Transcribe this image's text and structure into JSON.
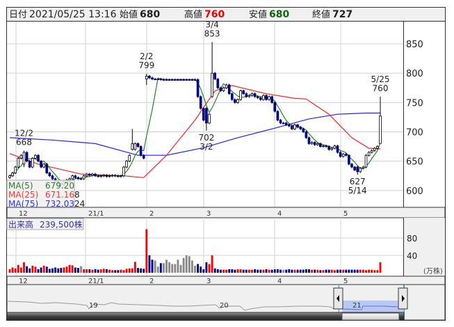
{
  "header": {
    "date_label": "日付",
    "datetime": "2021/05/25 13:16",
    "open_label": "始値",
    "open": "680",
    "high_label": "高値",
    "high": "760",
    "low_label": "安値",
    "low": "680",
    "close_label": "終値",
    "close": "727"
  },
  "colors": {
    "up_volume": "#ff0000",
    "down": "#000080",
    "flat": "#888888",
    "ma5": "#228822",
    "ma25": "#ff2020",
    "ma75": "#2020ff"
  },
  "legend": {
    "ma5_label": "MA(5)",
    "ma5_value": "679.20",
    "ma25_label": "MA(25)",
    "ma25_value": "671.16",
    "ma75_label": "MA(75)",
    "ma75_value": "732.03",
    "hidden_digits": "8",
    "hidden_digits2": "24"
  },
  "volume": {
    "label": "出来高",
    "value": "239,500株",
    "unit": "(万株)",
    "ticks": [
      "80",
      "40"
    ]
  },
  "navigator": {
    "labels": [
      "19",
      "20",
      "21"
    ]
  },
  "chart_data": {
    "type": "candlestick",
    "price_ticks": [
      "850",
      "800",
      "750",
      "700",
      "650",
      "600"
    ],
    "ylim": [
      575,
      880
    ],
    "month_labels": [
      {
        "label": "12",
        "index": 2
      },
      {
        "label": "21/1",
        "index": 26
      },
      {
        "label": "2",
        "index": 48
      },
      {
        "label": "3",
        "index": 68
      },
      {
        "label": "4",
        "index": 94
      },
      {
        "label": "5",
        "index": 117
      }
    ],
    "closes": [
      625,
      630,
      640,
      655,
      660,
      665,
      650,
      640,
      655,
      660,
      650,
      640,
      645,
      630,
      625,
      620,
      615,
      612,
      610,
      615,
      618,
      620,
      625,
      622,
      620,
      620,
      625,
      628,
      626,
      628,
      625,
      624,
      625,
      626,
      624,
      625,
      626,
      625,
      624,
      625,
      640,
      650,
      660,
      670,
      680,
      675,
      660,
      655,
      795,
      792,
      790,
      790,
      790,
      789,
      789,
      789,
      789,
      789,
      789,
      789,
      789,
      789,
      789,
      789,
      789,
      789,
      760,
      740,
      720,
      715,
      730,
      800,
      790,
      775,
      770,
      775,
      780,
      765,
      755,
      750,
      755,
      770,
      765,
      760,
      762,
      765,
      760,
      758,
      755,
      762,
      755,
      760,
      750,
      735,
      720,
      715,
      715,
      712,
      710,
      705,
      712,
      708,
      705,
      700,
      690,
      680,
      682,
      678,
      680,
      675,
      676,
      675,
      670,
      672,
      676,
      665,
      658,
      662,
      660,
      645,
      640,
      635,
      632,
      638,
      640,
      660,
      665,
      668,
      672,
      675,
      727
    ],
    "overrides": [
      {
        "index": 5,
        "o": 645,
        "h": 668,
        "l": 640,
        "c": 665
      },
      {
        "index": 43,
        "o": 670,
        "h": 705,
        "l": 668,
        "c": 680
      },
      {
        "index": 48,
        "o": 790,
        "h": 799,
        "l": 780,
        "c": 795
      },
      {
        "index": 69,
        "o": 740,
        "h": 742,
        "l": 702,
        "c": 715
      },
      {
        "index": 71,
        "o": 760,
        "h": 853,
        "l": 758,
        "c": 800
      },
      {
        "index": 122,
        "o": 640,
        "h": 642,
        "l": 627,
        "c": 632
      },
      {
        "index": 130,
        "o": 680,
        "h": 760,
        "l": 680,
        "c": 727
      }
    ],
    "annotations": [
      {
        "date": "12/2",
        "value": "668",
        "index": 5,
        "price": 668,
        "pos": "above"
      },
      {
        "date": "2/2",
        "value": "799",
        "index": 48,
        "price": 799,
        "pos": "above"
      },
      {
        "date": "3/2",
        "value": "702",
        "index": 69,
        "price": 702,
        "pos": "below"
      },
      {
        "date": "3/4",
        "value": "853",
        "index": 71,
        "price": 853,
        "pos": "above"
      },
      {
        "date": "5/14",
        "value": "627",
        "index": 122,
        "price": 627,
        "pos": "below"
      },
      {
        "date": "5/25",
        "value": "760",
        "index": 130,
        "price": 760,
        "pos": "above"
      }
    ],
    "ma25": [
      [
        0,
        663
      ],
      [
        10,
        645
      ],
      [
        25,
        628
      ],
      [
        40,
        625
      ],
      [
        47,
        622
      ],
      [
        55,
        660
      ],
      [
        65,
        720
      ],
      [
        72,
        770
      ],
      [
        78,
        779
      ],
      [
        90,
        765
      ],
      [
        100,
        757
      ],
      [
        104,
        756
      ],
      [
        112,
        730
      ],
      [
        120,
        690
      ],
      [
        126,
        672
      ],
      [
        130,
        671
      ]
    ],
    "ma75": [
      [
        0,
        690
      ],
      [
        15,
        686
      ],
      [
        30,
        680
      ],
      [
        45,
        660
      ],
      [
        55,
        660
      ],
      [
        68,
        673
      ],
      [
        80,
        690
      ],
      [
        92,
        705
      ],
      [
        105,
        722
      ],
      [
        115,
        730
      ],
      [
        125,
        732
      ],
      [
        130,
        732
      ]
    ],
    "volumes": [
      8,
      12,
      10,
      18,
      12,
      24,
      15,
      10,
      16,
      14,
      8,
      12,
      16,
      14,
      9,
      10,
      12,
      10,
      11,
      12,
      14,
      18,
      17,
      12,
      11,
      15,
      8,
      8,
      8,
      7,
      8,
      7,
      8,
      9,
      8,
      7,
      6,
      6,
      6,
      7,
      6,
      9,
      10,
      10,
      25,
      11,
      10,
      9,
      100,
      40,
      30,
      28,
      14,
      22,
      22,
      30,
      24,
      20,
      20,
      30,
      18,
      34,
      40,
      38,
      28,
      16,
      20,
      14,
      8,
      24,
      20,
      40,
      10,
      8,
      7,
      7,
      7,
      8,
      8,
      7,
      8,
      8,
      7,
      7,
      7,
      7,
      8,
      7,
      7,
      7,
      8,
      7,
      7,
      8,
      8,
      7,
      7,
      7,
      8,
      7,
      7,
      7,
      7,
      7,
      8,
      8,
      7,
      7,
      7,
      6,
      6,
      7,
      7,
      7,
      6,
      7,
      7,
      7,
      7,
      7,
      7,
      7,
      7,
      7,
      7,
      6,
      7,
      7,
      6,
      6,
      24
    ]
  }
}
